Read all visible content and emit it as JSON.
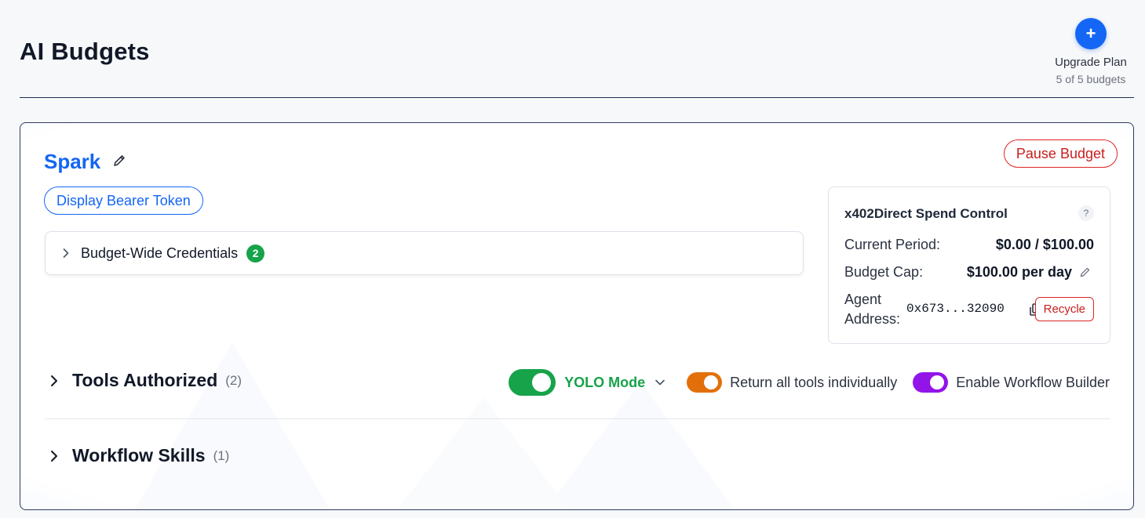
{
  "header": {
    "title": "AI Budgets",
    "upgrade": {
      "icon": "+",
      "label": "Upgrade Plan",
      "usage": "5 of 5 budgets"
    }
  },
  "budget": {
    "name": "Spark",
    "pause_label": "Pause Budget",
    "bearer_label": "Display Bearer Token",
    "credentials": {
      "label": "Budget-Wide Credentials",
      "count": "2"
    },
    "spend_control": {
      "title": "x402Direct Spend Control",
      "help": "?",
      "current_period_label": "Current Period:",
      "current_period_value": "$0.00 / $100.00",
      "budget_cap_label": "Budget Cap:",
      "budget_cap_value": "$100.00 per day",
      "agent_address_label_1": "Agent",
      "agent_address_label_2": "Address:",
      "agent_address_value": "0x673...32090",
      "recycle_label": "Recycle"
    },
    "tools": {
      "title": "Tools Authorized",
      "count": "(2)",
      "yolo_label": "YOLO Mode",
      "yolo_on": true,
      "return_individually_label": "Return all tools individually",
      "return_individually_on": true,
      "workflow_builder_label": "Enable Workflow Builder",
      "workflow_builder_on": true
    },
    "skills": {
      "title": "Workflow Skills",
      "count": "(1)"
    }
  },
  "colors": {
    "accent": "#1466f5",
    "danger": "#dc2626",
    "success": "#16a34a",
    "orange": "#e36f0a",
    "purple": "#9314e8"
  }
}
